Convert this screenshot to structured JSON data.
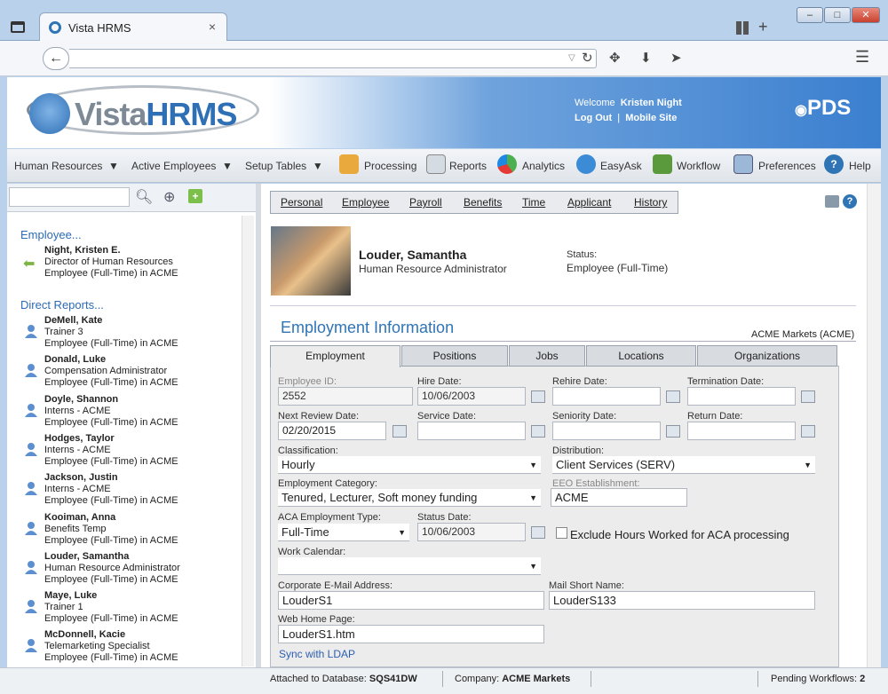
{
  "browser": {
    "tab_title": "Vista HRMS",
    "tab_close": "×",
    "min": "–",
    "max": "□",
    "close": "✕",
    "newtab": "+"
  },
  "header": {
    "logo": "VistaHRMS",
    "welcome_prefix": "Welcome",
    "user": "Kristen Night",
    "logout": "Log Out",
    "sep": "|",
    "mobile": "Mobile Site",
    "brand": "PDS"
  },
  "menu": {
    "hr": "Human Resources",
    "active": "Active Employees",
    "setup": "Setup Tables",
    "processing": "Processing",
    "reports": "Reports",
    "analytics": "Analytics",
    "easyask": "EasyAsk",
    "workflow": "Workflow",
    "preferences": "Preferences",
    "help": "Help"
  },
  "left": {
    "employee_heading": "Employee...",
    "self": {
      "name": "Night, Kristen E.",
      "title": "Director of Human Resources",
      "type": "Employee (Full-Time) in ACME"
    },
    "reports_heading": "Direct Reports...",
    "reports": [
      {
        "name": "DeMell, Kate",
        "title": "Trainer 3",
        "type": "Employee (Full-Time) in ACME"
      },
      {
        "name": "Donald, Luke",
        "title": "Compensation Administrator",
        "type": "Employee (Full-Time) in ACME"
      },
      {
        "name": "Doyle, Shannon",
        "title": "Interns - ACME",
        "type": "Employee (Full-Time) in ACME"
      },
      {
        "name": "Hodges, Taylor",
        "title": "Interns - ACME",
        "type": "Employee (Full-Time) in ACME"
      },
      {
        "name": "Jackson, Justin",
        "title": "Interns - ACME",
        "type": "Employee (Full-Time) in ACME"
      },
      {
        "name": "Kooiman, Anna",
        "title": "Benefits Temp",
        "type": "Employee (Full-Time) in ACME"
      },
      {
        "name": "Louder, Samantha",
        "title": "Human Resource Administrator",
        "type": "Employee (Full-Time) in ACME"
      },
      {
        "name": "Maye, Luke",
        "title": "Trainer 1",
        "type": "Employee (Full-Time) in ACME"
      },
      {
        "name": "McDonnell, Kacie",
        "title": "Telemarketing Specialist",
        "type": "Employee (Full-Time) in ACME"
      }
    ]
  },
  "tabs": [
    "Personal",
    "Employee",
    "Payroll",
    "Benefits",
    "Time",
    "Applicant",
    "History"
  ],
  "employee": {
    "name": "Louder, Samantha",
    "title": "Human Resource Administrator",
    "status_label": "Status:",
    "status": "Employee (Full-Time)"
  },
  "section": {
    "heading": "Employment Information",
    "company": "ACME Markets (ACME)"
  },
  "subtabs": [
    "Employment",
    "Positions",
    "Jobs",
    "Locations",
    "Organizations"
  ],
  "form": {
    "employee_id_label": "Employee ID:",
    "employee_id": "2552",
    "hire_label": "Hire Date:",
    "hire": "10/06/2003",
    "rehire_label": "Rehire Date:",
    "rehire": "",
    "term_label": "Termination Date:",
    "term": "",
    "review_label": "Next Review Date:",
    "review": "02/20/2015",
    "service_label": "Service Date:",
    "service": "",
    "seniority_label": "Seniority Date:",
    "seniority": "",
    "return_label": "Return Date:",
    "return": "",
    "class_label": "Classification:",
    "class": "Hourly",
    "dist_label": "Distribution:",
    "dist": "Client Services (SERV)",
    "cat_label": "Employment Category:",
    "cat": "Tenured, Lecturer, Soft money funding",
    "eeo_label": "EEO Establishment:",
    "eeo": "ACME",
    "aca_label": "ACA Employment Type:",
    "aca": "Full-Time",
    "status_date_label": "Status Date:",
    "status_date": "10/06/2003",
    "exclude_label": "Exclude Hours Worked for ACA processing",
    "cal_label": "Work Calendar:",
    "cal": "",
    "email_label": "Corporate E-Mail Address:",
    "email": "LouderS1",
    "mailshort_label": "Mail Short Name:",
    "mailshort": "LouderS133",
    "web_label": "Web Home Page:",
    "web": "LouderS1.htm",
    "sync": "Sync with LDAP"
  },
  "status": {
    "db_label": "Attached to Database:",
    "db": "SQS41DW",
    "co_label": "Company:",
    "co": "ACME Markets",
    "pend_label": "Pending Workflows:",
    "pend": "2"
  }
}
